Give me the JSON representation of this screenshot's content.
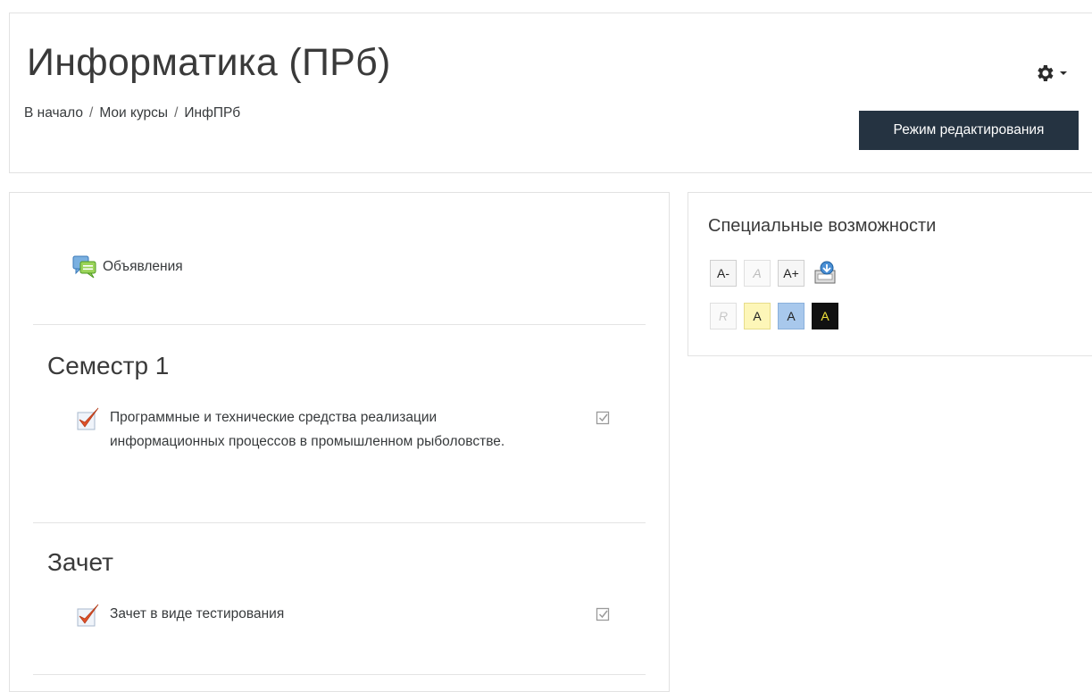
{
  "header": {
    "title": "Информатика (ПРб)",
    "breadcrumb": [
      "В начало",
      "Мои курсы",
      "ИнфПРб"
    ],
    "breadcrumb_separator": "/",
    "edit_button_label": "Режим редактирования",
    "gear_icon": "gear-icon",
    "accent_color": "#253341"
  },
  "course": {
    "announcements": {
      "label": "Объявления",
      "icon": "forum-icon"
    },
    "sections": [
      {
        "title": "Семестр 1",
        "activities": [
          {
            "label": "Программные и технические средства реализации информационных процессов в промышленном рыболовстве.",
            "icon": "quiz-icon",
            "completion": "manual-checkbox"
          }
        ]
      },
      {
        "title": "Зачет",
        "activities": [
          {
            "label": "Зачет в виде тестирования",
            "icon": "quiz-icon",
            "completion": "manual-checkbox"
          }
        ]
      }
    ]
  },
  "accessibility": {
    "title": "Специальные возможности",
    "font_buttons": [
      "A-",
      "A",
      "A+"
    ],
    "color_buttons": [
      "R",
      "A",
      "A",
      "A"
    ],
    "save_icon": "save-settings-icon"
  }
}
